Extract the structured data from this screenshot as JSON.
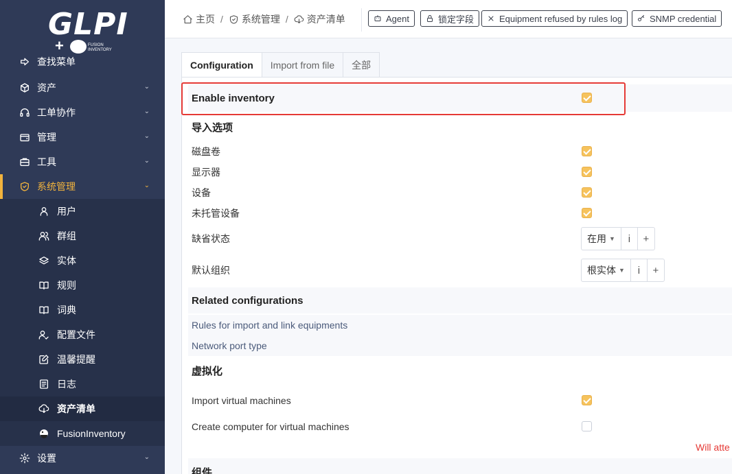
{
  "logo": {
    "text": "GLPI",
    "plugin_plus": "+",
    "plugin_line1": "FUSION",
    "plugin_line2": "INVENTORY"
  },
  "sidebar": {
    "items": [
      {
        "label": "查找菜单",
        "icon": "arrow-right-icon"
      },
      {
        "label": "资产",
        "icon": "cube-icon"
      },
      {
        "label": "工单协作",
        "icon": "headset-icon"
      },
      {
        "label": "管理",
        "icon": "wallet-icon"
      },
      {
        "label": "工具",
        "icon": "briefcase-icon"
      },
      {
        "label": "系统管理",
        "icon": "shield-check-icon"
      },
      {
        "label": "设置",
        "icon": "gear-icon"
      }
    ],
    "subitems": [
      {
        "label": "用户",
        "icon": "user-icon"
      },
      {
        "label": "群组",
        "icon": "users-icon"
      },
      {
        "label": "实体",
        "icon": "layers-icon"
      },
      {
        "label": "规则",
        "icon": "book-icon"
      },
      {
        "label": "词典",
        "icon": "book-icon"
      },
      {
        "label": "配置文件",
        "icon": "user-check-icon"
      },
      {
        "label": "温馨提醒",
        "icon": "note-edit-icon"
      },
      {
        "label": "日志",
        "icon": "news-icon"
      },
      {
        "label": "资产清单",
        "icon": "cloud-download-icon"
      },
      {
        "label": "FusionInventory",
        "icon": "fusion-logo-icon"
      }
    ]
  },
  "breadcrumb": {
    "home": "主页",
    "admin": "系统管理",
    "inventory": "资产清单",
    "sep": "/"
  },
  "toolbar": {
    "agent": "Agent",
    "locked_fields": "锁定字段",
    "refused_log": "Equipment refused by rules log",
    "snmp": "SNMP credential"
  },
  "tabs": [
    {
      "label": "Configuration",
      "active": true
    },
    {
      "label": "Import from file",
      "active": false
    },
    {
      "label": "全部",
      "active": false
    }
  ],
  "form": {
    "enable_inventory": {
      "label": "Enable inventory",
      "checked": true
    },
    "import_options_title": "导入选项",
    "import_options": [
      {
        "label": "磁盘卷",
        "checked": true
      },
      {
        "label": "显示器",
        "checked": true
      },
      {
        "label": "设备",
        "checked": true
      },
      {
        "label": "未托管设备",
        "checked": true
      }
    ],
    "default_status": {
      "label": "缺省状态",
      "value": "在用",
      "info": "i",
      "add": "+"
    },
    "default_entity": {
      "label": "默认组织",
      "value": "根实体",
      "info": "i",
      "add": "+"
    },
    "related_title": "Related configurations",
    "related_links": [
      "Rules for import and link equipments",
      "Network port type"
    ],
    "virtualization_title": "虚拟化",
    "import_vms": {
      "label": "Import virtual machines",
      "checked": true
    },
    "create_computer_vms": {
      "label": "Create computer for virtual machines",
      "checked": false
    },
    "warning_text": "Will atte",
    "components_title": "组件"
  },
  "colors": {
    "sidebar_bg": "#2f3a57",
    "accent": "#f2b33d",
    "checkbox": "#f6c35d",
    "highlight": "#e53935"
  }
}
